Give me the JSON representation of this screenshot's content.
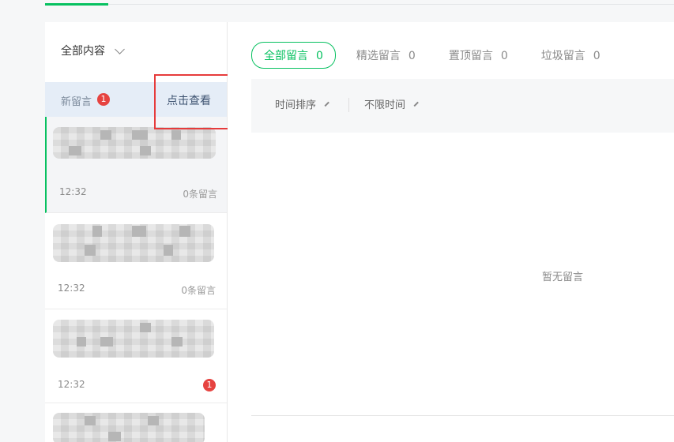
{
  "filter": {
    "label": "全部内容",
    "icon": "chevron-down-icon"
  },
  "new_messages": {
    "label": "新留言",
    "badge": "1",
    "action": "点击查看"
  },
  "messages": [
    {
      "time": "12:32",
      "count": "0条留言",
      "active": true
    },
    {
      "time": "12:32",
      "count": "0条留言",
      "active": false
    },
    {
      "time": "12:32",
      "badge": "1",
      "active": false
    },
    {
      "time": "",
      "active": false
    }
  ],
  "tabs": [
    {
      "label": "全部留言",
      "count": "0",
      "active": true
    },
    {
      "label": "精选留言",
      "count": "0"
    },
    {
      "label": "置顶留言",
      "count": "0"
    },
    {
      "label": "垃圾留言",
      "count": "0"
    }
  ],
  "sort": {
    "time_sort": "时间排序",
    "time_range": "不限时间"
  },
  "empty_text": "暂无留言",
  "colors": {
    "accent": "#07c160",
    "badge": "#e64340",
    "highlight": "#e63b3b"
  }
}
